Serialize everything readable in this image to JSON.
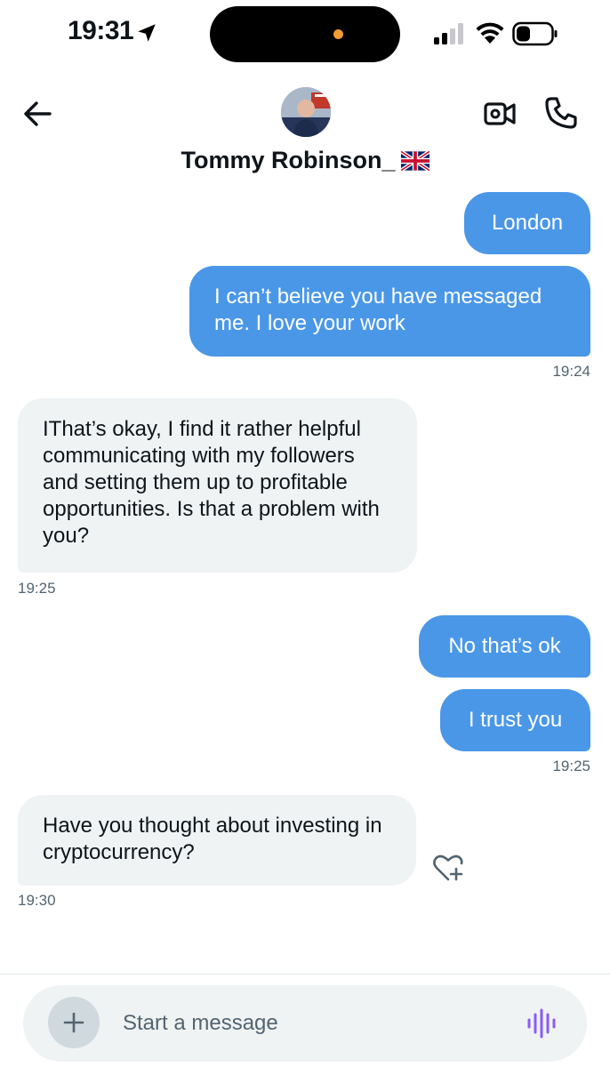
{
  "status_bar": {
    "time": "19:31"
  },
  "header": {
    "contact_name": "Tommy Robinson_",
    "flag_icon": "uk-flag-icon",
    "avatar_icon": "profile-photo"
  },
  "messages": {
    "m1": {
      "text": "London"
    },
    "m2": {
      "text": "I can’t believe you have messaged me. I love your work"
    },
    "t1": "19:24",
    "m3": {
      "text": "IThat’s okay, I find it rather helpful communicating with my followers and setting them up to profitable opportunities. Is that a problem with you?"
    },
    "t2": "19:25",
    "m4": {
      "text": "No that’s ok"
    },
    "m5": {
      "text": "I trust you"
    },
    "t3": "19:25",
    "m6": {
      "text": "Have you thought about investing in cryptocurrency?"
    },
    "t4": "19:30"
  },
  "composer": {
    "placeholder": "Start a message"
  },
  "colors": {
    "sent_bubble": "#4a97e8",
    "received_bubble": "#eff3f4",
    "voice_accent": "#8a5cf5"
  }
}
